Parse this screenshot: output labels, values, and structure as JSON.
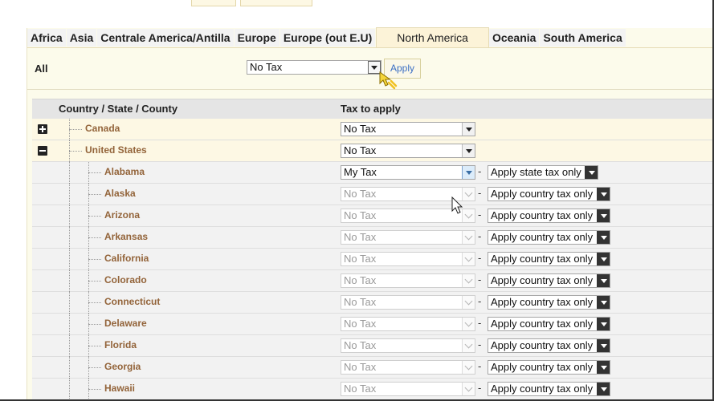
{
  "tabs": [
    {
      "label": "Africa",
      "active": false
    },
    {
      "label": "Asia",
      "active": false
    },
    {
      "label": "Centrale America/Antilla",
      "active": false
    },
    {
      "label": "Europe",
      "active": false
    },
    {
      "label": "Europe (out E.U)",
      "active": false
    },
    {
      "label": "North America",
      "active": true
    },
    {
      "label": "Oceania",
      "active": false
    },
    {
      "label": "South America",
      "active": false
    }
  ],
  "all_row": {
    "label": "All",
    "select_value": "No Tax",
    "apply_label": "Apply"
  },
  "table": {
    "col_country": "Country / State / County",
    "col_tax": "Tax to apply"
  },
  "countries": [
    {
      "name": "Canada",
      "expanded": false,
      "tax": "No Tax"
    },
    {
      "name": "United States",
      "expanded": true,
      "tax": "No Tax"
    }
  ],
  "states": [
    {
      "name": "Alabama",
      "tax": "My Tax",
      "mode": "Apply state tax only",
      "enabled": true
    },
    {
      "name": "Alaska",
      "tax": "No Tax",
      "mode": "Apply country tax only",
      "enabled": false
    },
    {
      "name": "Arizona",
      "tax": "No Tax",
      "mode": "Apply country tax only",
      "enabled": false
    },
    {
      "name": "Arkansas",
      "tax": "No Tax",
      "mode": "Apply country tax only",
      "enabled": false
    },
    {
      "name": "California",
      "tax": "No Tax",
      "mode": "Apply country tax only",
      "enabled": false
    },
    {
      "name": "Colorado",
      "tax": "No Tax",
      "mode": "Apply country tax only",
      "enabled": false
    },
    {
      "name": "Connecticut",
      "tax": "No Tax",
      "mode": "Apply country tax only",
      "enabled": false
    },
    {
      "name": "Delaware",
      "tax": "No Tax",
      "mode": "Apply country tax only",
      "enabled": false
    },
    {
      "name": "Florida",
      "tax": "No Tax",
      "mode": "Apply country tax only",
      "enabled": false
    },
    {
      "name": "Georgia",
      "tax": "No Tax",
      "mode": "Apply country tax only",
      "enabled": false
    },
    {
      "name": "Hawaii",
      "tax": "No Tax",
      "mode": "Apply country tax only",
      "enabled": false
    }
  ],
  "separator": "-",
  "colors": {
    "panel_bg": "#fcfbeb",
    "label_brown": "#93643a",
    "apply_text": "#3b6fc4"
  }
}
